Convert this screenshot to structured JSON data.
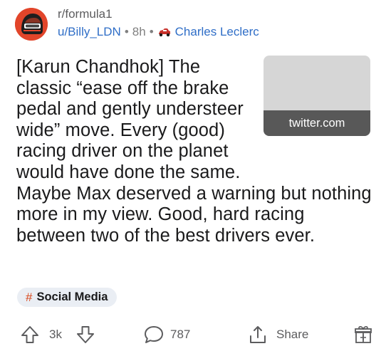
{
  "post": {
    "subreddit": "r/formula1",
    "author": "u/Billy_LDN",
    "time": "8h",
    "separator": "•",
    "flair": "Charles Leclerc",
    "title": "[Karun Chandhok] The classic “ease off the brake pedal and gently understeer wide” move. Every (good) racing driver on the planet would have done the same. Maybe Max deserved a warning but nothing more in my view. Good, hard racing between two of the best drivers ever.",
    "link_domain": "twitter.com",
    "tag_hash": "#",
    "tag": "Social Media"
  },
  "actions": {
    "votes": "3k",
    "comments": "787",
    "share": "Share"
  },
  "icons": {
    "upvote": "upvote-arrow-icon",
    "downvote": "downvote-arrow-icon",
    "comments": "speech-bubble-icon",
    "share": "share-icon",
    "award": "gift-award-icon",
    "flair": "race-car-icon"
  },
  "colors": {
    "link_blue": "#2f6ec7",
    "meta_gray": "#808080",
    "tag_hash": "#d9481c",
    "avatar_bg": "#e2452a",
    "tag_bg": "#eaeef4"
  }
}
